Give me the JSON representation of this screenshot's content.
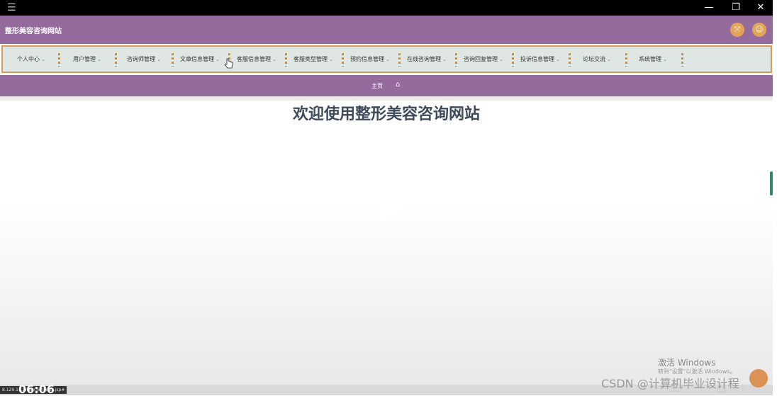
{
  "window": {
    "menu_icon": "hamburger-icon",
    "minimize": "—",
    "restore": "❐",
    "close": "✕"
  },
  "header": {
    "site_title": "整形美容咨询网站",
    "fullscreen_icon": "expand-icon",
    "user_icon": "user-icon",
    "accent": "#956a9c"
  },
  "nav": {
    "items": [
      {
        "label": "个人中心"
      },
      {
        "label": "用户管理"
      },
      {
        "label": "咨询师管理"
      },
      {
        "label": "文章信息管理"
      },
      {
        "label": "客服信息管理"
      },
      {
        "label": "客服类型管理"
      },
      {
        "label": "预约信息管理"
      },
      {
        "label": "在线咨询管理"
      },
      {
        "label": "咨询回复管理"
      },
      {
        "label": "投诉信息管理"
      },
      {
        "label": "论坛交流"
      },
      {
        "label": "系统管理"
      }
    ]
  },
  "breadcrumb": {
    "home": "主页",
    "home_icon": "house-icon"
  },
  "main": {
    "welcome": "欢迎使用整形美容咨询网站"
  },
  "overlay": {
    "activate_windows": "激活 Windows",
    "activate_hint": "转到\"设置\"以激活 Windows。",
    "csdn": "CSDN @计算机毕业设计程",
    "url": "8.129.1 …m89r3u/index.jsp#",
    "timer": "06:06"
  }
}
